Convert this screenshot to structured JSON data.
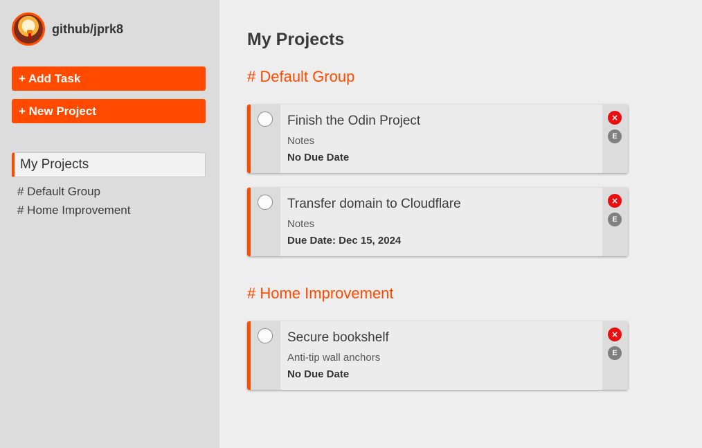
{
  "profile": {
    "username": "github/jprk8",
    "avatar_icon": "turkey-avatar-icon"
  },
  "sidebar": {
    "add_task_label": "+ Add Task",
    "new_project_label": "+ New Project",
    "my_projects_label": "My Projects",
    "groups": [
      "# Default Group",
      "# Home Improvement"
    ]
  },
  "main": {
    "title": "My Projects",
    "groups": [
      {
        "title": "# Default Group",
        "tasks": [
          {
            "title": "Finish the Odin Project",
            "notes": "Notes",
            "due": "No Due Date"
          },
          {
            "title": "Transfer domain to Cloudflare",
            "notes": "Notes",
            "due": "Due Date: Dec 15, 2024"
          }
        ]
      },
      {
        "title": "# Home Improvement",
        "tasks": [
          {
            "title": "Secure bookshelf",
            "notes": "Anti-tip wall anchors",
            "due": "No Due Date"
          }
        ]
      }
    ],
    "delete_icon_label": "×",
    "edit_icon_label": "E"
  },
  "colors": {
    "accent": "#ff4a00",
    "sidebar_bg": "#dcdcdc",
    "main_bg": "#eeeeee",
    "delete": "#e81010",
    "edit": "#808080"
  }
}
